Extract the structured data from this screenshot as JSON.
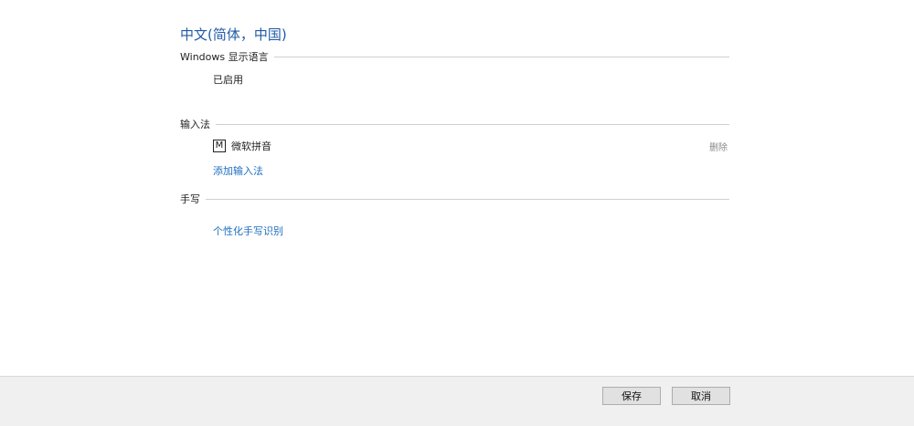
{
  "page": {
    "title": "中文(简体，中国)"
  },
  "display_language": {
    "heading": "Windows 显示语言",
    "status": "已启用"
  },
  "input_methods": {
    "heading": "输入法",
    "items": [
      {
        "icon": "M",
        "icon_name": "ime-m-icon",
        "name": "微软拼音",
        "remove_label": "删除"
      }
    ],
    "add_label": "添加输入法"
  },
  "handwriting": {
    "heading": "手写",
    "personalize_label": "个性化手写识别"
  },
  "footer": {
    "save_label": "保存",
    "cancel_label": "取消"
  },
  "colors": {
    "title": "#1e5aa6",
    "link": "#1f6fc0",
    "rule": "#cfcfcf",
    "footer_bg": "#f0f0f0"
  }
}
